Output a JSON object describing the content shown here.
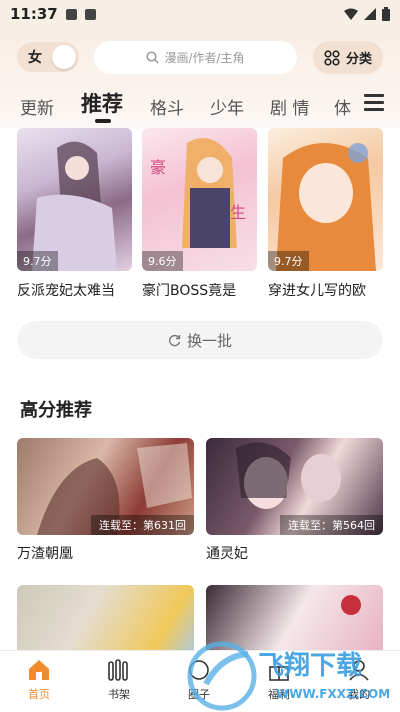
{
  "status_bar": {
    "time": "11:37"
  },
  "header": {
    "gender_label": "女",
    "search_placeholder": "漫画/作者/主角",
    "category_label": "分类"
  },
  "tabs": [
    {
      "label": "更新"
    },
    {
      "label": "推荐"
    },
    {
      "label": "格斗"
    },
    {
      "label": "少年"
    },
    {
      "label": "剧 情"
    },
    {
      "label": "体"
    }
  ],
  "top_comics": [
    {
      "title": "反派宠妃太难当",
      "chapter": "9.7分"
    },
    {
      "title": "豪门BOSS竟是",
      "chapter": "9.6分"
    },
    {
      "title": "穿进女儿写的欧",
      "chapter": "9.7分"
    }
  ],
  "refresh_label": "换一批",
  "section": {
    "title": "高分推荐",
    "items": [
      {
        "title": "万渣朝凰",
        "status": "连载至：第631回"
      },
      {
        "title": "通灵妃",
        "status": "连载至：第564回"
      }
    ]
  },
  "bottom_nav": [
    {
      "label": "首页"
    },
    {
      "label": "书架"
    },
    {
      "label": "圈子"
    },
    {
      "label": "福利"
    },
    {
      "label": "我的"
    }
  ],
  "watermark": {
    "text": "飞翔下载",
    "url_text": "WWW.FXXZ.COM"
  },
  "colors": {
    "accent": "#f08c2e",
    "header_bg": "#f7eee6"
  }
}
